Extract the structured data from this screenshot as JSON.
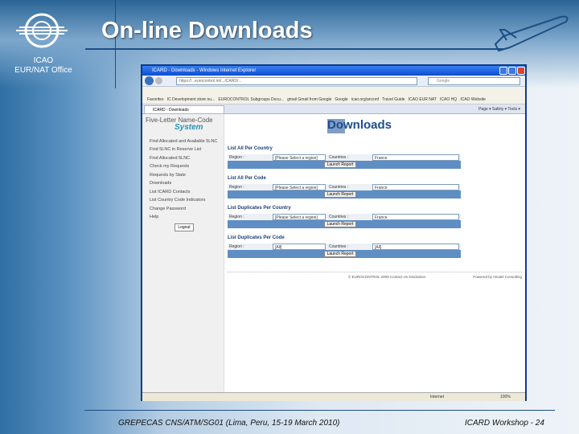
{
  "slide": {
    "title": "On-line Downloads",
    "org_line1": "ICAO",
    "org_line2": "EUR/NAT Office",
    "footer_left": "GREPECAS CNS/ATM/SG01 (Lima, Peru, 15-19 March 2010)",
    "footer_right": "ICARD Workshop - 24"
  },
  "browser": {
    "window_title": "ICARD - Downloads - Windows Internet Explorer",
    "url": "https://...eurocontrol.int/...ICARD/...",
    "search_placeholder": "Google",
    "favorites": [
      "Favorites",
      "IC Development store nu...",
      "EUROCONTROL Subgroups Docu...",
      "gmail Gmail from Google",
      "Google",
      "icao.org/anconf",
      "Travel Guide",
      "ICAO EUR NAT",
      "ICAO HQ",
      "ICAO Website"
    ],
    "tab_label": "ICARD - Downloads",
    "toolbar": "Page ▾  Safety ▾  Tools ▾",
    "status_zone": "Internet",
    "status_zoom": "100%"
  },
  "sidebar": {
    "brand_line1": "Five-Letter Name-Code",
    "brand_line2": "System",
    "items": [
      "Find Allocated and Available 5LNC",
      "Find 5LNC in Reserve List",
      "Find Allocated 5LNC",
      "Check my Requests",
      "Requests by State",
      "Downloads",
      "List ICARD Contacts",
      "List Country Code Indicators",
      "Change Password",
      "Help"
    ],
    "logout": "Logout"
  },
  "main": {
    "logo": "Downloads",
    "sections": [
      {
        "title": "List All Per Country",
        "region_label": "Region :",
        "region": "[Please Select a region]",
        "countries_label": "Countries :",
        "country": "France",
        "button": "Launch Report"
      },
      {
        "title": "List All Per Code",
        "region_label": "Region :",
        "region": "[Please Select a region]",
        "countries_label": "Countries :",
        "country": "France",
        "button": "Launch Report"
      },
      {
        "title": "List Duplicates Per Country",
        "region_label": "Region :",
        "region": "[Please Select a region]",
        "countries_label": "Countries :",
        "country": "France",
        "button": "Launch Report"
      },
      {
        "title": "List Duplicates Per Code",
        "region_label": "Region :",
        "region": "[All]",
        "countries_label": "Countries :",
        "country": "[All]",
        "button": "Launch Report"
      }
    ],
    "footer_left": "© EUROCONTROL 2009  Contact Us  Disclaimer",
    "footer_right": "Powered by Alcatel Consulting"
  }
}
